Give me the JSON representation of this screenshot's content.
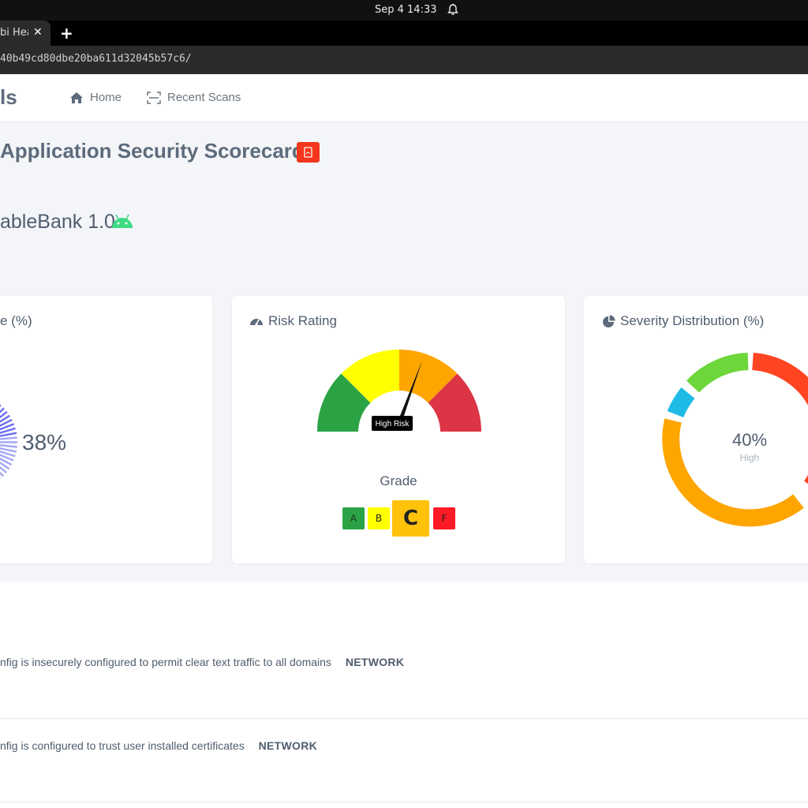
{
  "os": {
    "clock": "Sep 4  14:33",
    "bell_icon": "bell-icon"
  },
  "browser": {
    "tab_title": "bi Hea",
    "close_label": "✕",
    "new_tab_label": "+",
    "url": "40b49cd80dbe20ba611d32045b57c6/"
  },
  "nav": {
    "brand": "ls",
    "home": "Home",
    "recent_scans": "Recent Scans"
  },
  "page": {
    "title": "Application Security Scorecard",
    "app_name": "ableBank 1.0"
  },
  "cards": {
    "security": {
      "title": "e (%)",
      "score": "38%",
      "score_value": 38
    },
    "risk": {
      "title": "Risk Rating",
      "needle_label": "High Risk",
      "grade_label": "Grade",
      "grades": [
        "A",
        "B",
        "C",
        "F"
      ],
      "active_grade": "C"
    },
    "severity": {
      "title": "Severity Distribution (%)",
      "center_value": "40%",
      "center_label": "High",
      "colors": {
        "high": "#ffa500",
        "critical": "#ff4422",
        "medium": "#6dd63a",
        "info": "#1ebbe6"
      }
    }
  },
  "findings": [
    {
      "text": "nfig is insecurely configured to permit clear text traffic to all domains",
      "tag": "NETWORK"
    },
    {
      "text": "nfig is configured to trust user installed certificates",
      "tag": "NETWORK"
    }
  ]
}
